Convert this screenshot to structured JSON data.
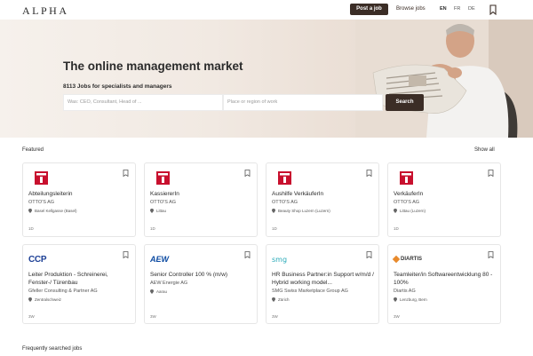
{
  "header": {
    "logo": "ALPHA",
    "post_job": "Post a job",
    "browse_jobs": "Browse jobs",
    "languages": [
      "EN",
      "FR",
      "DE"
    ],
    "active_language": "EN",
    "bookmark_icon": "bookmark-icon"
  },
  "hero": {
    "title": "The online management market",
    "subtitle": "8113 Jobs for specialists and managers",
    "what_placeholder": "Was: CEO, Consultant, Head of ...",
    "where_placeholder": "Place or region of work",
    "search_button": "Search"
  },
  "featured": {
    "label": "Featured",
    "show_all": "Show all",
    "cards": [
      {
        "logo": "OTTO'S",
        "title": "Abteilungsleiterin",
        "company": "OTTO'S AG",
        "location": "Basel Kellgasse (Basel)",
        "age": "1D"
      },
      {
        "logo": "OTTO'S",
        "title": "KassiererIn",
        "company": "OTTO'S AG",
        "location": "Littau",
        "age": "1D"
      },
      {
        "logo": "OTTO'S",
        "title": "Aushilfe VerkäuferIn",
        "company": "OTTO'S AG",
        "location": "Beauty Shop Luzern (Luzern)",
        "age": "1D"
      },
      {
        "logo": "OTTO'S",
        "title": "VerkäuferIn",
        "company": "OTTO'S AG",
        "location": "Littau (Luzern)",
        "age": "1D"
      },
      {
        "logo": "CCP",
        "title": "Leiter Produktion - Schreinerei, Fenster-/ Türenbau",
        "company": "Gfeller Consulting & Partner AG",
        "location": "Zentralschweiz",
        "age": "3W"
      },
      {
        "logo": "AEW",
        "title": "Senior Controller 100 % (m/w)",
        "company": "AEW Energie AG",
        "location": "Aarau",
        "age": "3W"
      },
      {
        "logo": "smg",
        "title": "HR Business Partner:in Support w/m/d / Hybrid working model...",
        "company": "SMG Swiss Marketplace Group AG",
        "location": "Zürich",
        "age": "3W"
      },
      {
        "logo": "DIARTIS",
        "title": "Teamleiter/in Softwareentwicklung 80 - 100%",
        "company": "Diartis AG",
        "location": "Lenzburg, Bern",
        "age": "3W"
      }
    ]
  },
  "frequently": {
    "label": "Frequently searched jobs"
  }
}
